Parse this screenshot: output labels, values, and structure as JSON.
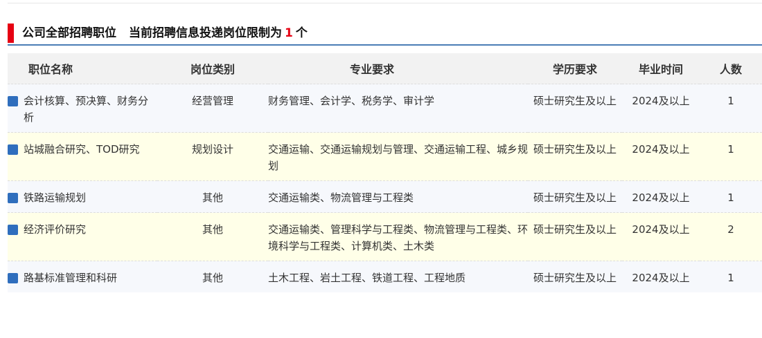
{
  "section": {
    "title": "公司全部招聘职位",
    "subtitle_prefix": "当前招聘信息投递岗位限制为",
    "limit": "1",
    "subtitle_suffix": "个"
  },
  "table": {
    "headers": [
      "职位名称",
      "岗位类别",
      "专业要求",
      "学历要求",
      "毕业时间",
      "人数"
    ],
    "rows": [
      {
        "name": "会计核算、预决算、财务分析",
        "type": "经营管理",
        "major": "财务管理、会计学、税务学、审计学",
        "education": "硕士研究生及以上",
        "graduation": "2024及以上",
        "count": "1"
      },
      {
        "name": "站城融合研究、TOD研究",
        "type": "规划设计",
        "major": "交通运输、交通运输规划与管理、交通运输工程、城乡规划",
        "education": "硕士研究生及以上",
        "graduation": "2024及以上",
        "count": "1"
      },
      {
        "name": "铁路运输规划",
        "type": "其他",
        "major": "交通运输类、物流管理与工程类",
        "education": "硕士研究生及以上",
        "graduation": "2024及以上",
        "count": "1"
      },
      {
        "name": "经济评价研究",
        "type": "其他",
        "major": "交通运输类、管理科学与工程类、物流管理与工程类、环境科学与工程类、计算机类、土木类",
        "education": "硕士研究生及以上",
        "graduation": "2024及以上",
        "count": "2"
      },
      {
        "name": "路基标准管理和科研",
        "type": "其他",
        "major": "土木工程、岩土工程、铁道工程、工程地质",
        "education": "硕士研究生及以上",
        "graduation": "2024及以上",
        "count": "1"
      }
    ]
  },
  "colors": {
    "accent_bar": "#e60012",
    "limit_number": "#e60012",
    "header_rule": "#4a7db5",
    "row_icon": "#2f6ebd",
    "row_odd_bg": "#f6f8fc",
    "row_even_bg": "#ffffe8",
    "header_bg": "#f2f2f2"
  },
  "icons": {
    "row_marker": "job-square-icon"
  }
}
